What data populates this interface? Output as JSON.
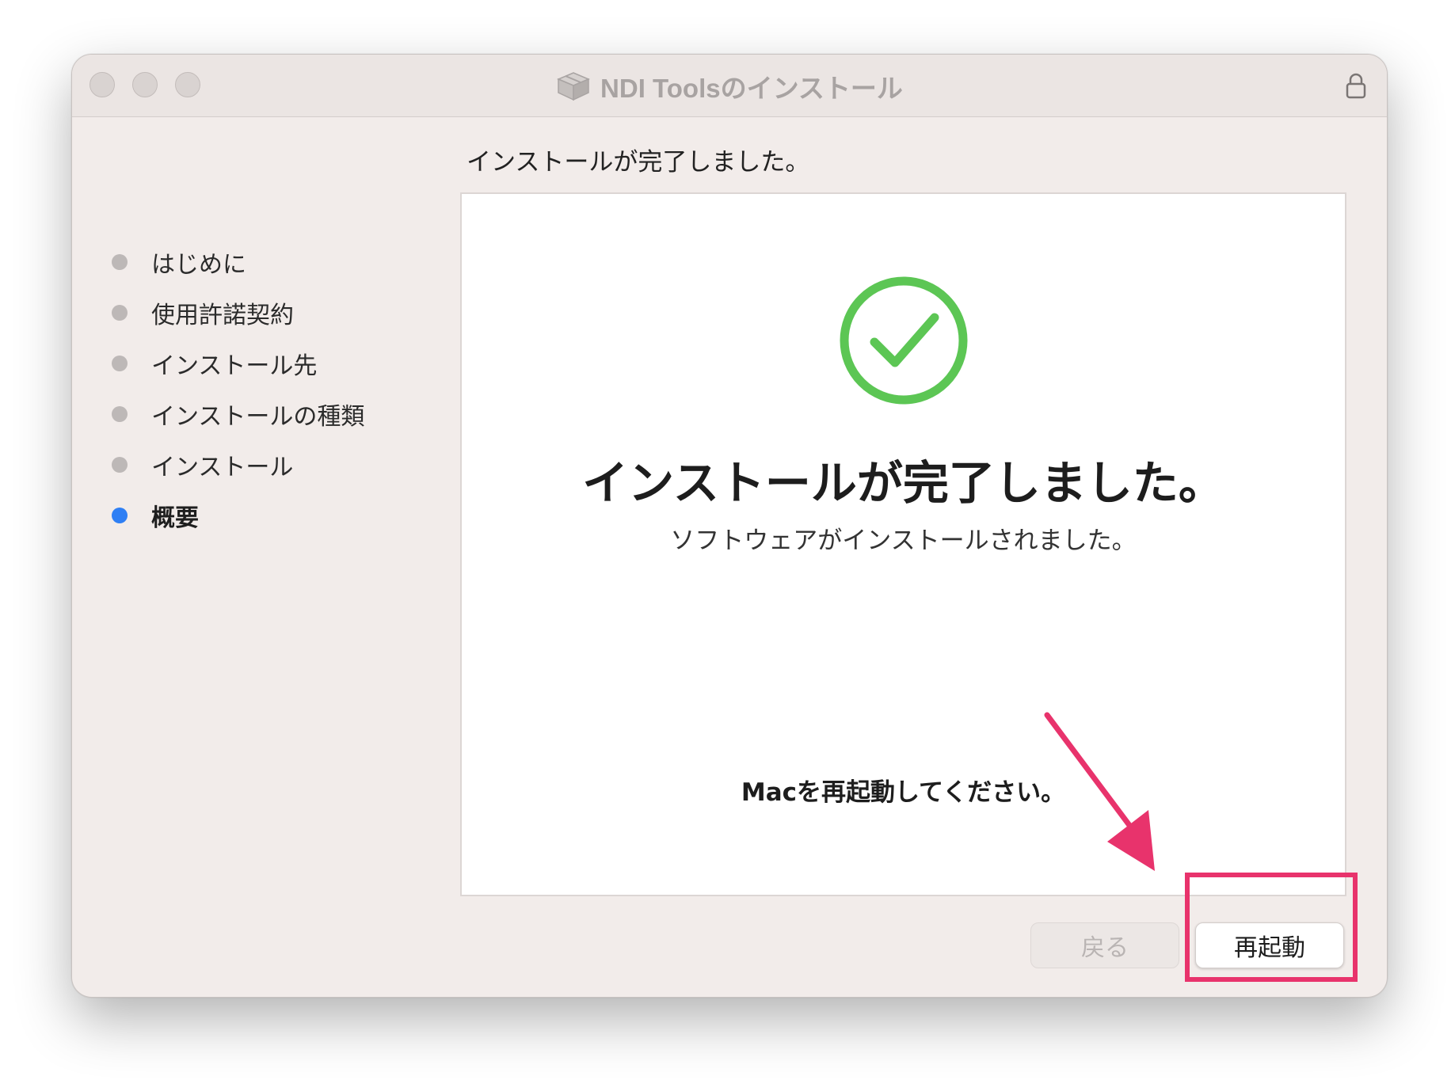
{
  "window": {
    "title": "NDI Toolsのインストール"
  },
  "sidebar": {
    "steps": [
      {
        "label": "はじめに",
        "active": false
      },
      {
        "label": "使用許諾契約",
        "active": false
      },
      {
        "label": "インストール先",
        "active": false
      },
      {
        "label": "インストールの種類",
        "active": false
      },
      {
        "label": "インストール",
        "active": false
      },
      {
        "label": "概要",
        "active": true
      }
    ]
  },
  "main": {
    "heading": "インストールが完了しました。",
    "content_title": "インストールが完了しました。",
    "content_subtitle": "ソフトウェアがインストールされました。",
    "restart_message": "Macを再起動してください。"
  },
  "buttons": {
    "back_label": "戻る",
    "restart_label": "再起動"
  },
  "colors": {
    "success_green": "#5cc654",
    "active_step_blue": "#2f7ff4",
    "annotation_pink": "#e8336c"
  },
  "icons": {
    "title": "installer-package-icon",
    "lock": "lock-icon",
    "success": "check-circle-icon",
    "annotation": "arrow-annotation-icon"
  }
}
